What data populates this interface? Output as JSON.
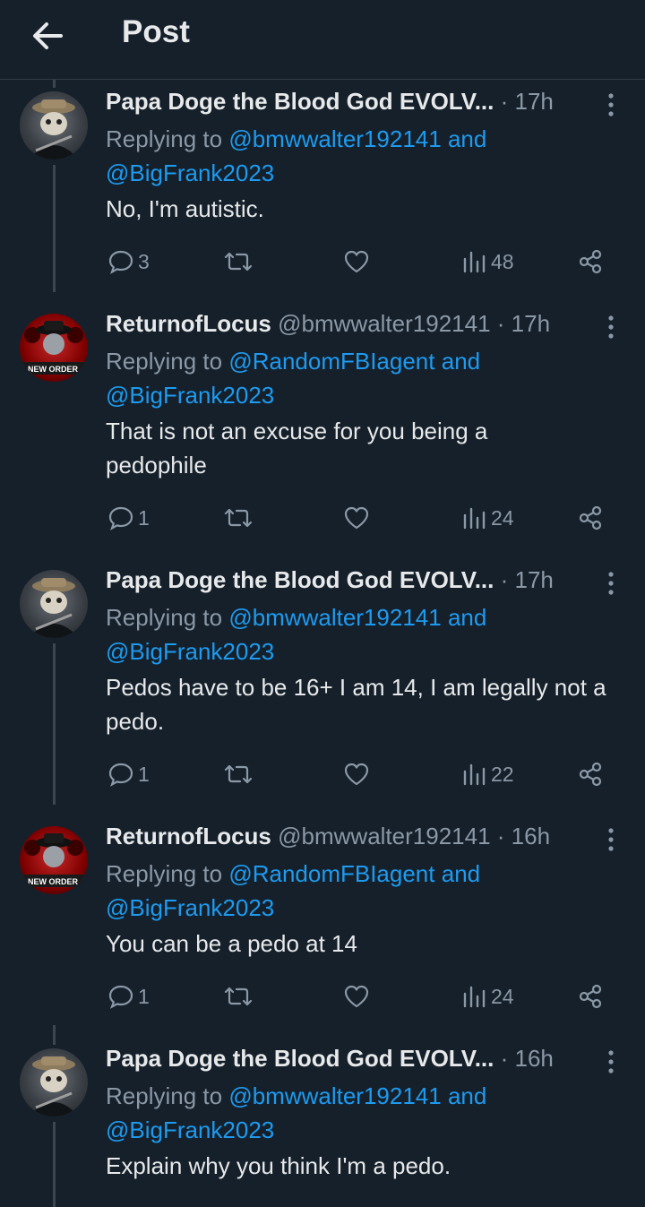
{
  "header": {
    "title": "Post"
  },
  "tweets": [
    {
      "name": "Papa Doge the Blood God EVOLV...",
      "handle": "",
      "time": "17h",
      "reply_prefix": "Replying to",
      "reply_mention_1": "@bmwwalter192141",
      "reply_and": "and",
      "reply_mention_2": "@BigFrank2023",
      "text": "No, I'm autistic.",
      "replies": "3",
      "views": "48"
    },
    {
      "name": "ReturnofLocus",
      "handle": "@bmwwalter192141",
      "time": "17h",
      "reply_prefix": "Replying to",
      "reply_mention_1": "@RandomFBIagent",
      "reply_and": "and",
      "reply_mention_2": "@BigFrank2023",
      "text": "That is not an excuse for you being a pedophile",
      "replies": "1",
      "views": "24"
    },
    {
      "name": "Papa Doge the Blood God EVOLV...",
      "handle": "",
      "time": "17h",
      "reply_prefix": "Replying to",
      "reply_mention_1": "@bmwwalter192141",
      "reply_and": "and",
      "reply_mention_2": "@BigFrank2023",
      "text": "Pedos have to be 16+ I am 14, I am legally not a pedo.",
      "replies": "1",
      "views": "22"
    },
    {
      "name": "ReturnofLocus",
      "handle": "@bmwwalter192141",
      "time": "16h",
      "reply_prefix": "Replying to",
      "reply_mention_1": "@RandomFBIagent",
      "reply_and": "and",
      "reply_mention_2": "@BigFrank2023",
      "text": "You can be a pedo at 14",
      "replies": "1",
      "views": "24"
    },
    {
      "name": "Papa Doge the Blood God EVOLV...",
      "handle": "",
      "time": "16h",
      "reply_prefix": "Replying to",
      "reply_mention_1": "@bmwwalter192141",
      "reply_and": "and",
      "reply_mention_2": "@BigFrank2023",
      "text": "Explain why you think I'm a pedo."
    }
  ],
  "icons": {
    "back": "arrow-left-icon",
    "reply": "speech-bubble-icon",
    "repost": "repost-arrows-icon",
    "like": "heart-icon",
    "views": "bar-chart-icon",
    "share": "share-icon",
    "more": "vertical-dots-icon"
  },
  "colors": {
    "background": "#15202b",
    "text": "#e7e9ea",
    "muted": "#8b98a5",
    "link": "#1d9bf0"
  }
}
